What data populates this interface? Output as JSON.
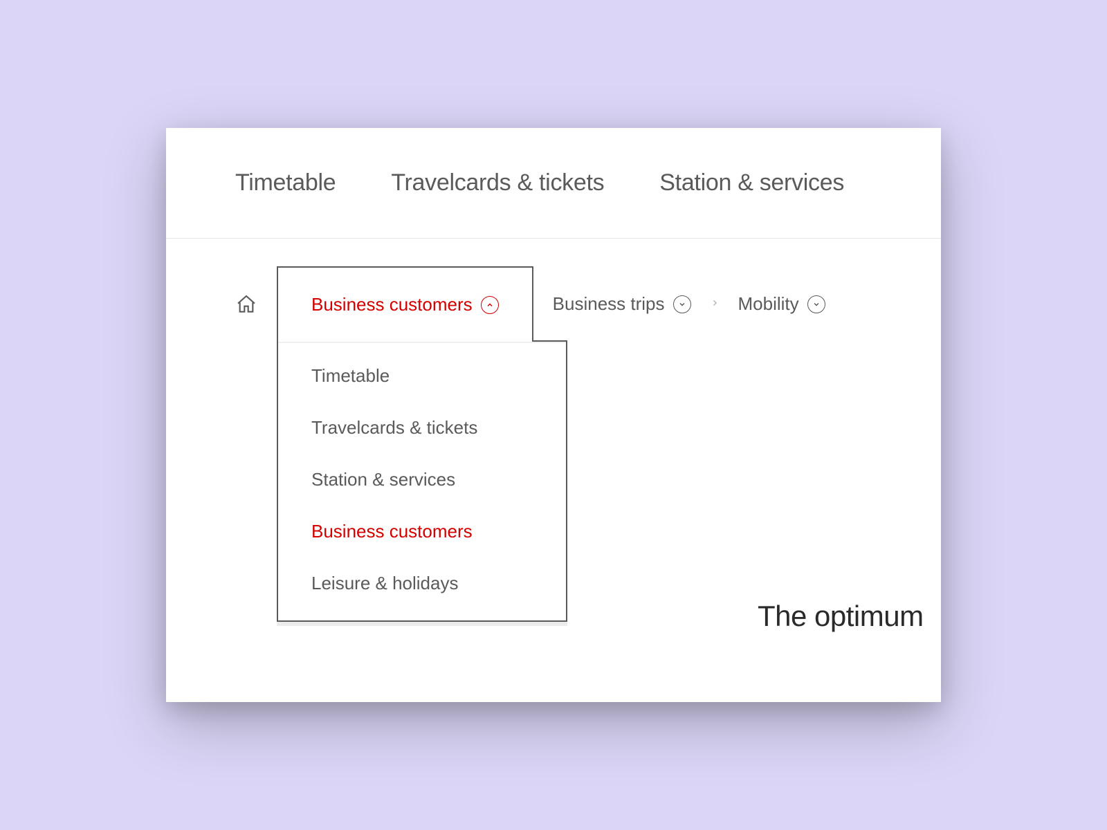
{
  "colors": {
    "accent": "#d40000",
    "text": "#5a5a5a",
    "background_page": "#dbd6f7"
  },
  "top_nav": {
    "items": [
      {
        "label": "Timetable"
      },
      {
        "label": "Travelcards & tickets"
      },
      {
        "label": "Station & services"
      }
    ]
  },
  "breadcrumb": {
    "home_icon": "home-icon",
    "items": [
      {
        "label": "Business customers",
        "expanded": true,
        "active": true
      },
      {
        "label": "Business trips",
        "expanded": false,
        "active": false
      },
      {
        "label": "Mobility",
        "expanded": false,
        "active": false
      }
    ]
  },
  "dropdown": {
    "items": [
      {
        "label": "Timetable",
        "selected": false
      },
      {
        "label": "Travelcards & tickets",
        "selected": false
      },
      {
        "label": "Station & services",
        "selected": false
      },
      {
        "label": "Business customers",
        "selected": true
      },
      {
        "label": "Leisure & holidays",
        "selected": false
      }
    ]
  },
  "main": {
    "partial_heading": "The optimum"
  }
}
